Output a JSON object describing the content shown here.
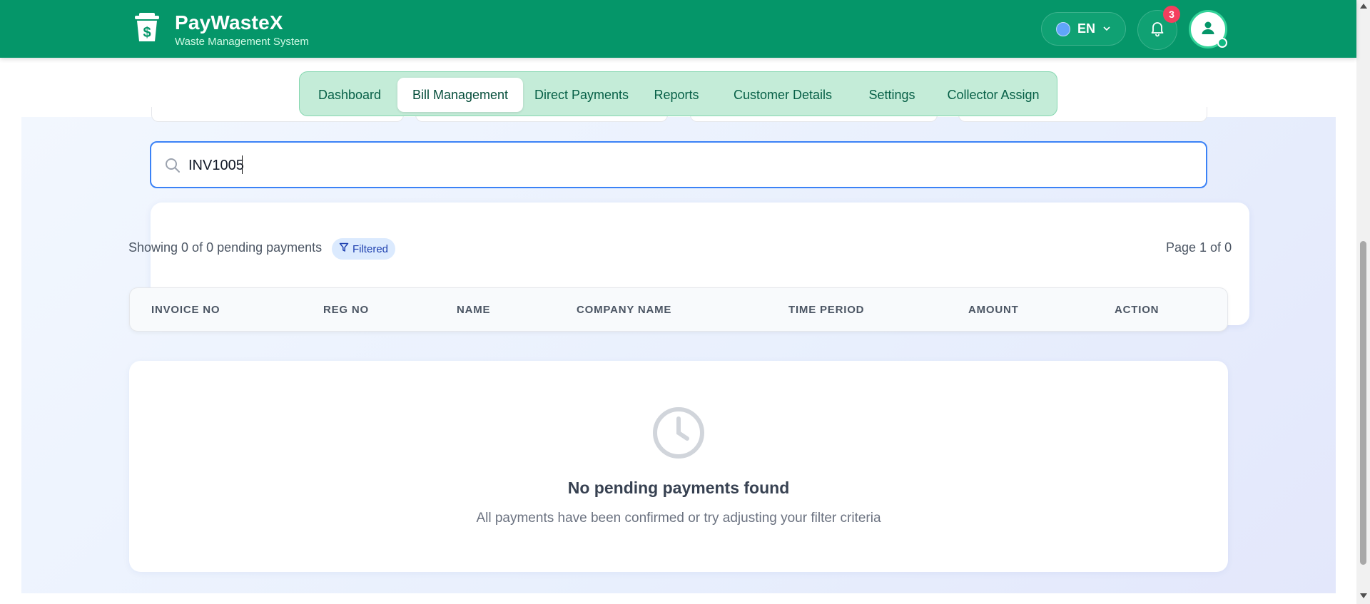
{
  "header": {
    "brand_title": "PayWasteX",
    "brand_subtitle": "Waste Management System",
    "language": "EN",
    "notification_count": "3",
    "colors": {
      "primary": "#059669",
      "badge": "#f43f5e"
    }
  },
  "nav": {
    "tabs": [
      {
        "label": "Dashboard",
        "active": false
      },
      {
        "label": "Bill Management",
        "active": true
      },
      {
        "label": "Direct Payments",
        "active": false
      },
      {
        "label": "Reports",
        "active": false
      },
      {
        "label": "Customer Details",
        "active": false
      },
      {
        "label": "Settings",
        "active": false
      },
      {
        "label": "Collector Assign",
        "active": false
      }
    ]
  },
  "search": {
    "value": "INV1005",
    "placeholder": ""
  },
  "summary": {
    "showing_text": "Showing 0 of 0 pending payments",
    "filter_chip": "Filtered",
    "page_info": "Page 1 of 0"
  },
  "table": {
    "columns": [
      "INVOICE NO",
      "REG NO",
      "NAME",
      "COMPANY NAME",
      "TIME PERIOD",
      "AMOUNT",
      "ACTION"
    ],
    "rows": []
  },
  "empty_state": {
    "icon": "clock-icon",
    "title": "No pending payments found",
    "description": "All payments have been confirmed or try adjusting your filter criteria"
  }
}
